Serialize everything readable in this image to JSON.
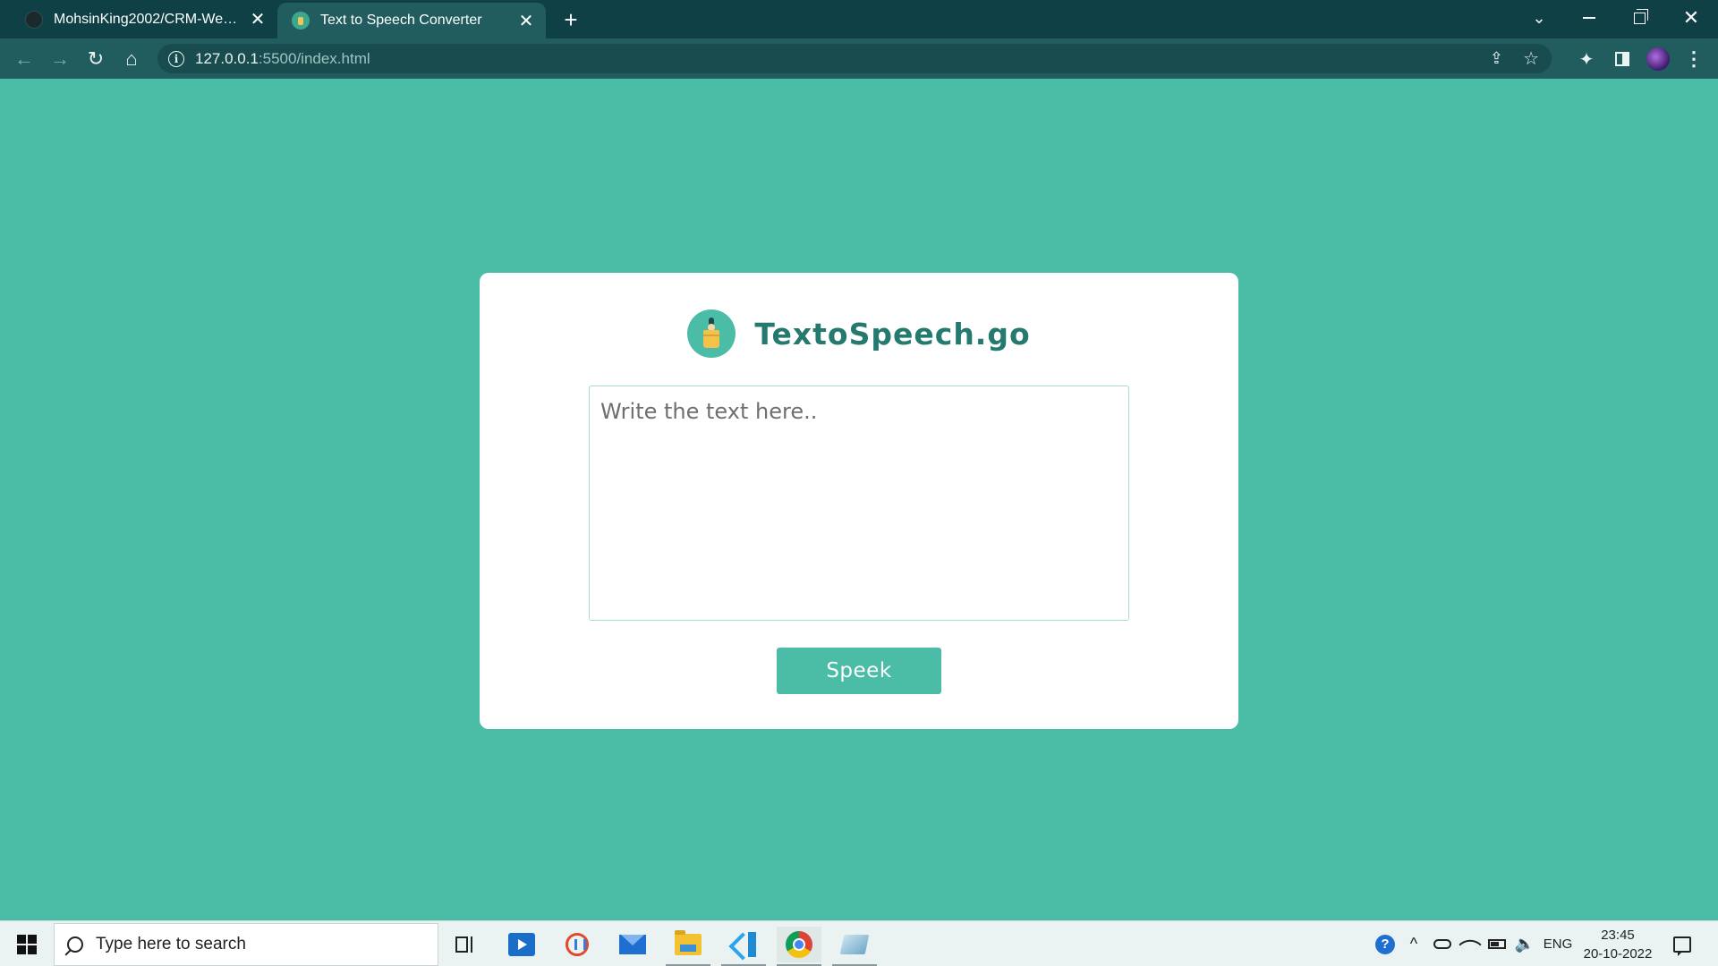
{
  "browser": {
    "tabs": [
      {
        "title": "MohsinKing2002/CRM-Website",
        "close": "✕",
        "favicon": "github-icon"
      },
      {
        "title": "Text to Speech Converter",
        "close": "✕",
        "favicon": "speaker-podium-icon"
      }
    ],
    "new_tab": "+",
    "url_host": "127.0.0.1",
    "url_path": ":5500/index.html",
    "window_buttons": {
      "tab_search": "⌄",
      "close": "✕"
    },
    "toolbar": {
      "back": "←",
      "forward": "→",
      "reload": "↻",
      "home": "⌂",
      "info": "i",
      "share": "⇪",
      "bookmark": "☆",
      "extensions": "✦",
      "menu": "⋮"
    }
  },
  "page": {
    "brand_name": "TextoSpeech.go",
    "textarea_placeholder": "Write the text here..",
    "textarea_value": "",
    "speak_button": "Speek",
    "colors": {
      "background": "#4bbca6",
      "brand_text": "#247a6e",
      "card": "#ffffff"
    }
  },
  "taskbar": {
    "search_placeholder": "Type here to search",
    "apps": [
      "task-view",
      "video-editor",
      "snipping-tool",
      "mail",
      "file-explorer",
      "vs-code",
      "chrome",
      "notepad"
    ],
    "tray": {
      "up": "^",
      "volume": "🔈",
      "language": "ENG",
      "help": "?"
    },
    "clock": {
      "time": "23:45",
      "date": "20-10-2022"
    }
  }
}
